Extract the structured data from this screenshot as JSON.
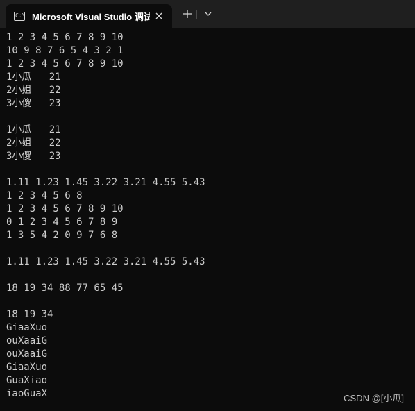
{
  "window": {
    "tab_title": "Microsoft Visual Studio 调试控制台",
    "tab_icon": "terminal-icon",
    "close_icon": "close-icon",
    "new_tab_icon": "plus-icon",
    "dropdown_icon": "chevron-down-icon"
  },
  "console": {
    "lines": [
      "1 2 3 4 5 6 7 8 9 10",
      "10 9 8 7 6 5 4 3 2 1",
      "1 2 3 4 5 6 7 8 9 10",
      "1小瓜   21",
      "2小姐   22",
      "3小傻   23",
      "",
      "1小瓜   21",
      "2小姐   22",
      "3小傻   23",
      "",
      "1.11 1.23 1.45 3.22 3.21 4.55 5.43",
      "1 2 3 4 5 6 8",
      "1 2 3 4 5 6 7 8 9 10",
      "0 1 2 3 4 5 6 7 8 9",
      "1 3 5 4 2 0 9 7 6 8",
      "",
      "1.11 1.23 1.45 3.22 3.21 4.55 5.43",
      "",
      "18 19 34 88 77 65 45",
      "",
      "18 19 34",
      "GiaaXuo",
      "ouXaaiG",
      "ouXaaiG",
      "GiaaXuo",
      "GuaXiao",
      "iaoGuaX"
    ]
  },
  "watermark": "CSDN @[小瓜]"
}
